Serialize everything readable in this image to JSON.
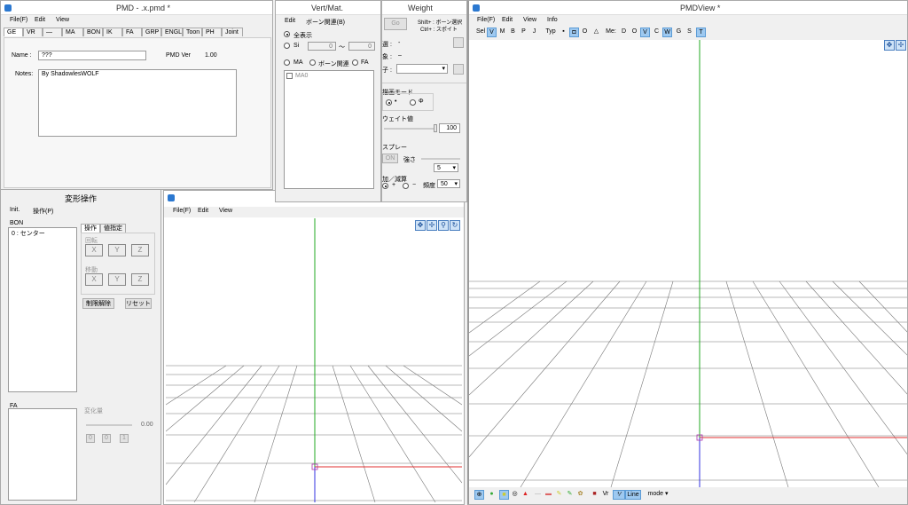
{
  "pmd_window": {
    "title": "PMD   - .x.pmd *",
    "menu": [
      "File(F)",
      "Edit",
      "View"
    ],
    "tabs": [
      "GE",
      "VR",
      "—",
      "MA",
      "BON",
      "IK",
      "FA",
      "GRP",
      "ENGL",
      "Toon",
      "PH",
      "Joint"
    ],
    "name_label": "Name :",
    "name_value": "???",
    "version_label": "PMD Ver",
    "version_value": "1.00",
    "notes_label": "Notes:",
    "notes_value": "By ShadowlesWOLF"
  },
  "transform_panel": {
    "title": "変形操作",
    "menu": [
      "Init.",
      "操作(P)"
    ],
    "bon_label": "BON",
    "bon_items": [
      "0 : センター"
    ],
    "tabs": [
      "操作",
      "値指定"
    ],
    "rotate_label": "回転",
    "move_label": "移動",
    "axes": [
      "X",
      "Y",
      "Z"
    ],
    "release_button": "制限解除",
    "reset_button": "リセット",
    "fa_label": "FA",
    "change_label": "変化量",
    "change_value": "0.00",
    "small_buttons": [
      "0",
      "0",
      "1"
    ]
  },
  "vert_window": {
    "title": "Vert/Mat.",
    "menu": [
      "Edit",
      "ボーン関連(B)"
    ],
    "show_all": "全表示",
    "si_label": "Si",
    "si_from": "0",
    "si_tilde": "〜",
    "si_to": "0",
    "filters": [
      "MA",
      "ボーン関連",
      "FA"
    ],
    "list_item": "MA0"
  },
  "weight_window": {
    "title": "Weight",
    "go_button": "Go",
    "shift_hint": "Shift+ : ボーン選択",
    "ctrl_hint": "Ctrl+ : スポイト",
    "row1": "選 :",
    "row1_val": "-",
    "row2": "象 :",
    "row2_val": "–",
    "row3": "子 :",
    "draw_mode_label": "描画モード",
    "draw_options": [
      "•",
      "Φ"
    ],
    "weight_label": "ウェイト値",
    "weight_value": "100",
    "spray_label": "スプレー",
    "spray_on": "ON",
    "strength_label": "強さ",
    "strength_value": "5",
    "addsub_label": "加／減算",
    "addsub_options": [
      "+",
      "−"
    ],
    "freq_label": "頻度",
    "freq_value": "50"
  },
  "small_view": {
    "menu": [
      "File(F)",
      "Edit",
      "View"
    ]
  },
  "pmdview": {
    "title": "PMDView *",
    "menu": [
      "File(F)",
      "Edit",
      "View",
      "Info"
    ],
    "toolbar": [
      "Sel",
      "V",
      "M",
      "B",
      "P",
      "J",
      "Typ",
      "▪",
      "◘",
      "O",
      "△",
      "Me:",
      "D",
      "O",
      "V",
      "C",
      "W",
      "G",
      "S",
      "T"
    ],
    "bottom_labels": [
      "Vr",
      "Line",
      "mode ▾"
    ]
  },
  "colors": {
    "x_axis": "#e03030",
    "y_axis": "#22aa22",
    "z_axis": "#3030e0",
    "grid": "#777777",
    "accent": "#9ec9f0"
  }
}
